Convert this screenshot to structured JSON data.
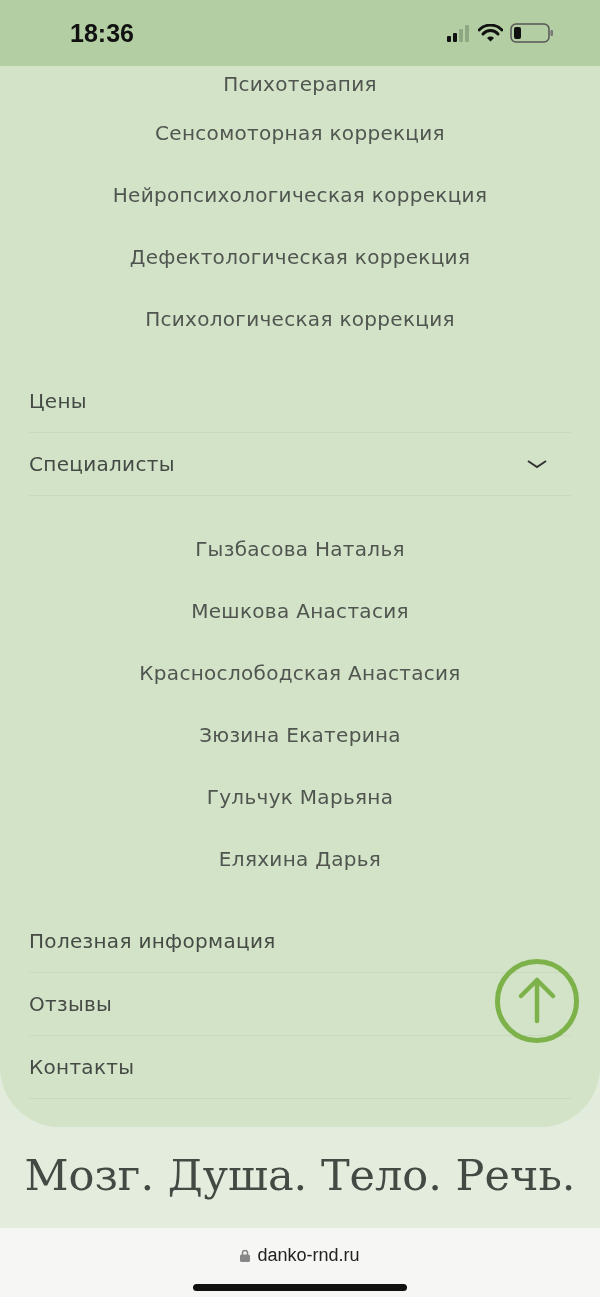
{
  "status_bar": {
    "time": "18:36"
  },
  "submenu_top": [
    "Психотерапия",
    "Сенсомоторная коррекция",
    "Нейропсихологическая коррекция",
    "Дефектологическая коррекция",
    "Психологическая коррекция"
  ],
  "nav": [
    {
      "label": "Цены",
      "kind": "link"
    },
    {
      "label": "Специалисты",
      "kind": "dropdown",
      "expanded": true,
      "children": [
        "Гызбасова Наталья",
        "Мешкова Анастасия",
        "Краснослободская Анастасия",
        "Зюзина Екатерина",
        "Гульчук Марьяна",
        "Еляхина Дарья"
      ]
    },
    {
      "label": "Полезная информация",
      "kind": "link"
    },
    {
      "label": "Отзывы",
      "kind": "link"
    },
    {
      "label": "Контакты",
      "kind": "link"
    }
  ],
  "tagline": "Мозг. Душа. Тело. Речь.",
  "browser": {
    "url": "danko-rnd.ru"
  }
}
